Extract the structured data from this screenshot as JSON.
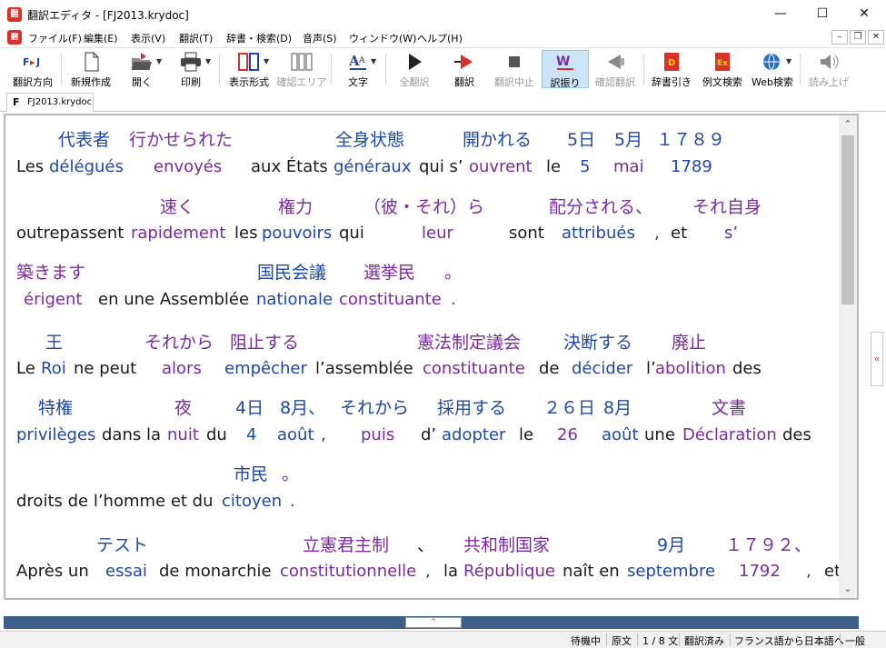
{
  "window": {
    "title": "翻訳エディタ - [FJ2013.krydoc]",
    "app_icon": "翻"
  },
  "menu": [
    "ファイル(F)",
    "編集(E)",
    "表示(V)",
    "翻訳(T)",
    "辞書・検索(D)",
    "音声(S)",
    "ウィンドウ(W)",
    "ヘルプ(H)"
  ],
  "toolbar": {
    "direction": "翻訳方向",
    "new": "新規作成",
    "open": "開く",
    "print": "印刷",
    "layout": "表示形式",
    "confirm_area": "確認エリア",
    "text": "文字",
    "translate_all": "全翻訳",
    "translate": "翻訳",
    "stop": "翻訳中止",
    "furigana": "訳振り",
    "confirm_translate": "確認翻訳",
    "dict_lookup": "辞書引き",
    "example_search": "例文検索",
    "web_search": "Web検索",
    "read_aloud": "読み上げ"
  },
  "tab": {
    "label": "FJ2013.krydoc"
  },
  "lines": [
    {
      "ja": [
        [
          "代表者",
          "b",
          52
        ],
        [
          "行かせられた",
          "p",
          130
        ],
        [
          "全身状態",
          "b",
          357
        ],
        [
          "開かれる",
          "b",
          497
        ],
        [
          "5日",
          "b",
          612
        ],
        [
          "5月",
          "b",
          664
        ],
        [
          "１７８９",
          "b",
          710
        ]
      ],
      "fr": [
        [
          "Les",
          "k",
          6
        ],
        [
          "délégués",
          "b",
          42
        ],
        [
          "envoyés",
          "p",
          157
        ],
        [
          "aux États",
          "k",
          264
        ],
        [
          "généraux",
          "b",
          355
        ],
        [
          "qui s’",
          "k",
          449
        ],
        [
          "ouvrent",
          "p",
          504
        ],
        [
          "le",
          "k",
          589
        ],
        [
          "5",
          "b",
          626
        ],
        [
          "mai",
          "p",
          663
        ],
        [
          "1789",
          "b",
          726
        ]
      ]
    },
    {
      "ja": [
        [
          "速く",
          "p",
          164
        ],
        [
          "権力",
          "p",
          294
        ],
        [
          "（彼・それ）ら",
          "p",
          388
        ],
        [
          "配分される、",
          "p",
          592
        ],
        [
          "それ自身",
          "p",
          750
        ]
      ],
      "fr": [
        [
          "outrepassent",
          "k",
          6
        ],
        [
          "rapidement",
          "p",
          132
        ],
        [
          "les",
          "k",
          246
        ],
        [
          "pouvoirs",
          "b",
          276
        ],
        [
          "qui",
          "k",
          361
        ],
        [
          "leur",
          "p",
          452
        ],
        [
          "sont",
          "k",
          548
        ],
        [
          "attribués",
          "b",
          606
        ],
        [
          ",",
          "p",
          708
        ],
        [
          "et",
          "k",
          726
        ],
        [
          "s’",
          "p",
          785
        ]
      ]
    },
    {
      "ja": [
        [
          "築きます",
          "p",
          6
        ],
        [
          "国民会議",
          "b",
          271
        ],
        [
          "選挙民",
          "p",
          388
        ],
        [
          "。",
          "p",
          477
        ]
      ],
      "fr": [
        [
          "érigent",
          "p",
          14
        ],
        [
          "en une Assemblée",
          "k",
          96
        ],
        [
          "nationale",
          "b",
          270
        ],
        [
          "constituante",
          "p",
          361
        ],
        [
          ".",
          "b",
          484
        ]
      ]
    },
    {
      "ja": [
        [
          "王",
          "b",
          38
        ],
        [
          "それから",
          "p",
          147
        ],
        [
          "阻止する",
          "p",
          241
        ],
        [
          "憲法制定議会",
          "p",
          447
        ],
        [
          "決断する",
          "b",
          608
        ],
        [
          "廃止",
          "p",
          727
        ]
      ],
      "fr": [
        [
          "Le",
          "k",
          6
        ],
        [
          "Roi",
          "b",
          33
        ],
        [
          "ne peut",
          "k",
          69
        ],
        [
          "alors",
          "p",
          166
        ],
        [
          "empêcher",
          "b",
          235
        ],
        [
          "l’assemblée",
          "k",
          335
        ],
        [
          "constituante",
          "p",
          453
        ],
        [
          "de",
          "k",
          581
        ],
        [
          "décider",
          "b",
          617
        ],
        [
          "l’",
          "k",
          699
        ],
        [
          "abolition",
          "p",
          709
        ],
        [
          "des",
          "k",
          794
        ]
      ]
    },
    {
      "ja": [
        [
          "特権",
          "b",
          30
        ],
        [
          "夜",
          "p",
          180
        ],
        [
          "4日",
          "b",
          247
        ],
        [
          "8月、",
          "b",
          296
        ],
        [
          "それから",
          "b",
          362
        ],
        [
          "採用する",
          "b",
          469
        ],
        [
          "２６日",
          "b",
          586
        ],
        [
          "8月",
          "b",
          652
        ],
        [
          "文書",
          "p",
          771
        ]
      ],
      "fr": [
        [
          "privilèges",
          "b",
          6
        ],
        [
          "dans la",
          "k",
          100
        ],
        [
          "nuit",
          "p",
          172
        ],
        [
          "du",
          "k",
          215
        ],
        [
          "4",
          "b",
          259
        ],
        [
          "août",
          "b",
          293
        ],
        [
          ",",
          "b",
          341
        ],
        [
          "puis",
          "p",
          385
        ],
        [
          "d’",
          "k",
          451
        ],
        [
          "adopter",
          "b",
          474
        ],
        [
          "le",
          "k",
          559
        ],
        [
          "26",
          "p",
          601
        ],
        [
          "août",
          "b",
          650
        ],
        [
          "une",
          "k",
          697
        ],
        [
          "Déclaration",
          "p",
          739
        ],
        [
          "des",
          "k",
          849
        ]
      ]
    },
    {
      "ja": [
        [
          "市民",
          "b",
          245
        ],
        [
          "。",
          "p",
          298
        ]
      ],
      "fr": [
        [
          "droits de l’homme et du",
          "k",
          6
        ],
        [
          "citoyen",
          "b",
          232
        ],
        [
          ".",
          "b",
          307
        ]
      ]
    },
    {
      "ja": [
        [
          "テスト",
          "b",
          94
        ],
        [
          "立憲君主制",
          "p",
          321
        ],
        [
          "、",
          "k",
          447
        ],
        [
          "共和制国家",
          "p",
          498
        ],
        [
          "9月",
          "b",
          711
        ],
        [
          "１７９２、",
          "p",
          786
        ]
      ],
      "fr": [
        [
          "Après un",
          "k",
          6
        ],
        [
          "essai",
          "b",
          104
        ],
        [
          "de monarchie",
          "k",
          163
        ],
        [
          "constitutionnelle",
          "p",
          296
        ],
        [
          ",",
          "b",
          456
        ],
        [
          "la",
          "k",
          476
        ],
        [
          "République",
          "p",
          498
        ],
        [
          "naît en",
          "k",
          607
        ],
        [
          "septembre",
          "b",
          678
        ],
        [
          "1792",
          "p",
          801
        ],
        [
          ",",
          "b",
          875
        ],
        [
          "et",
          "k",
          895
        ]
      ]
    }
  ],
  "status": {
    "state": "待機中",
    "view": "原文",
    "count": "1 / 8 文",
    "translated": "翻訳済み",
    "direction": "フランス語から日本語へ",
    "mode": "一般"
  },
  "colors": {
    "blue": "#1f47a8",
    "purple": "#7a2aa0",
    "accent_panel": "#3b5f86"
  }
}
